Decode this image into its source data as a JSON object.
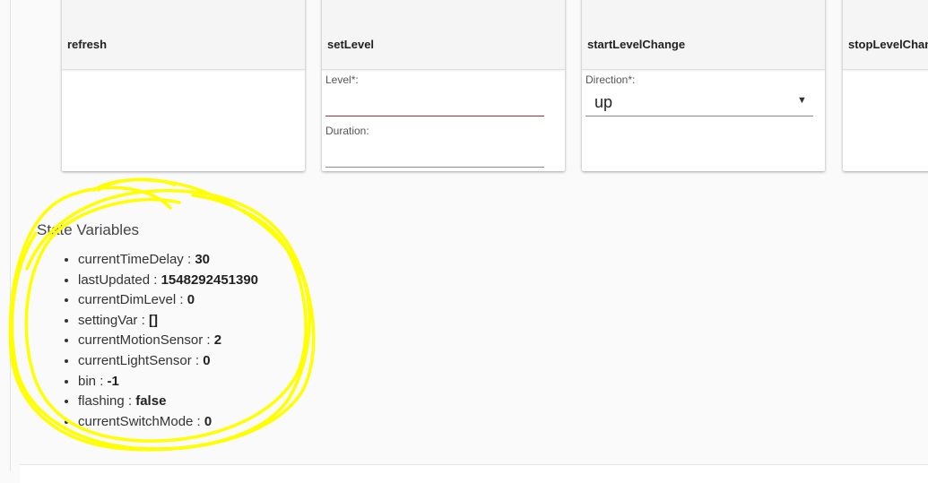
{
  "commands": [
    {
      "title": "refresh"
    },
    {
      "title": "setLevel",
      "fields": [
        {
          "label": "Level*:"
        },
        {
          "label": "Duration:"
        }
      ]
    },
    {
      "title": "startLevelChange",
      "fields": [
        {
          "label": "Direction*:",
          "value": "up"
        }
      ]
    },
    {
      "title": "stopLevelChange"
    }
  ],
  "state_variables": {
    "title": "State Variables",
    "items": [
      {
        "name": "currentTimeDelay",
        "sep": " : ",
        "value": "30"
      },
      {
        "name": "lastUpdated",
        "sep": " : ",
        "value": "1548292451390"
      },
      {
        "name": "currentDimLevel",
        "sep": " : ",
        "value": "0"
      },
      {
        "name": "settingVar",
        "sep": " : ",
        "value": "[]"
      },
      {
        "name": "currentMotionSensor",
        "sep": " : ",
        "value": "2"
      },
      {
        "name": "currentLightSensor",
        "sep": " : ",
        "value": "0"
      },
      {
        "name": "bin",
        "sep": " : ",
        "value": "-1"
      },
      {
        "name": "flashing",
        "sep": " : ",
        "value": "false"
      },
      {
        "name": "currentSwitchMode",
        "sep": " : ",
        "value": "0"
      }
    ]
  },
  "colors": {
    "highlight_annotation": "#ffff00",
    "invalid_underline": "#b02a37"
  }
}
